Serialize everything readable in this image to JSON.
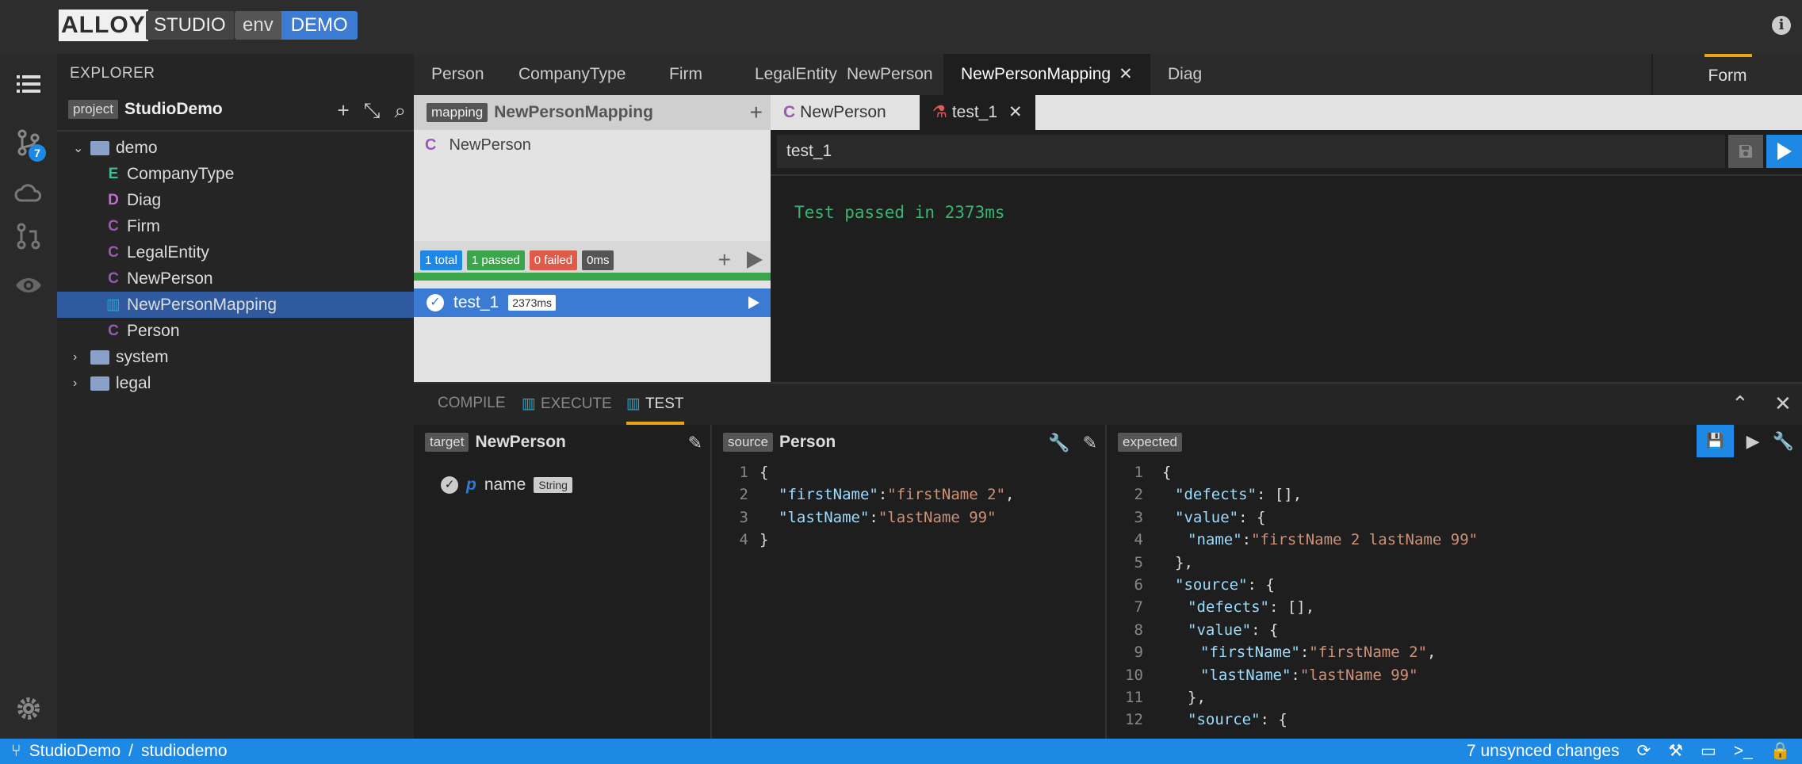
{
  "header": {
    "logo": "ALLOY",
    "studio": "STUDIO",
    "env_label": "env",
    "env_value": "DEMO"
  },
  "activity": {
    "badge_count": "7"
  },
  "explorer": {
    "title": "EXPLORER",
    "project_tag": "project",
    "project_name": "StudioDemo",
    "tree": [
      {
        "label": "demo",
        "type": "folder-open"
      },
      {
        "label": "CompanyType",
        "icon": "E",
        "color": "#3fbf8f"
      },
      {
        "label": "Diag",
        "icon": "D",
        "color": "#c26dd0"
      },
      {
        "label": "Firm",
        "icon": "C",
        "color": "#9b59b6"
      },
      {
        "label": "LegalEntity",
        "icon": "C",
        "color": "#9b59b6"
      },
      {
        "label": "NewPerson",
        "icon": "C",
        "color": "#9b59b6"
      },
      {
        "label": "NewPersonMapping",
        "icon": "map",
        "color": "#2aa3c4",
        "selected": true
      },
      {
        "label": "Person",
        "icon": "C",
        "color": "#9b59b6"
      },
      {
        "label": "system",
        "type": "folder"
      },
      {
        "label": "legal",
        "type": "folder"
      }
    ]
  },
  "tabs": [
    "Person",
    "CompanyType",
    "Firm",
    "LegalEntity",
    "NewPerson",
    "NewPersonMapping",
    "Diag"
  ],
  "form_tab": "Form",
  "mapping": {
    "tag": "mapping",
    "name": "NewPersonMapping",
    "class_icon": "C",
    "class_name": "NewPerson",
    "stats": {
      "total": "1 total",
      "passed": "1 passed",
      "failed": "0 failed",
      "time": "0ms"
    },
    "test": {
      "name": "test_1",
      "time": "2373ms"
    }
  },
  "test_tabs": {
    "class_icon": "C",
    "class_tab": "NewPerson",
    "test_tab": "test_1"
  },
  "test_name_value": "test_1",
  "test_result": "Test passed in 2373ms",
  "bottom": {
    "tabs": [
      "COMPILE",
      "EXECUTE",
      "TEST"
    ],
    "target_tag": "target",
    "target_name": "NewPerson",
    "prop_letter": "p",
    "prop_name": "name",
    "prop_type": "String",
    "source_tag": "source",
    "source_name": "Person",
    "expected_tag": "expected"
  },
  "source_code": [
    {
      "n": "1",
      "t": "{"
    },
    {
      "n": "2",
      "k": "\"firstName\"",
      "v": "\"firstName 2\"",
      "e": ","
    },
    {
      "n": "3",
      "k": "\"lastName\"",
      "v": "\"lastName 99\"",
      "e": ""
    },
    {
      "n": "4",
      "t": "}"
    }
  ],
  "expected_code": [
    {
      "n": "1",
      "i": 0,
      "t": "{"
    },
    {
      "n": "2",
      "i": 1,
      "k": "\"defects\"",
      "p": ": [],"
    },
    {
      "n": "3",
      "i": 1,
      "k": "\"value\"",
      "p": ": {"
    },
    {
      "n": "4",
      "i": 2,
      "k": "\"name\"",
      "v": "\"firstName 2 lastName 99\"",
      "e": ""
    },
    {
      "n": "5",
      "i": 1,
      "t": "},"
    },
    {
      "n": "6",
      "i": 1,
      "k": "\"source\"",
      "p": ": {"
    },
    {
      "n": "7",
      "i": 2,
      "k": "\"defects\"",
      "p": ": [],"
    },
    {
      "n": "8",
      "i": 2,
      "k": "\"value\"",
      "p": ": {"
    },
    {
      "n": "9",
      "i": 3,
      "k": "\"firstName\"",
      "v": "\"firstName 2\"",
      "e": ","
    },
    {
      "n": "10",
      "i": 3,
      "k": "\"lastName\"",
      "v": "\"lastName 99\"",
      "e": ""
    },
    {
      "n": "11",
      "i": 2,
      "t": "},"
    },
    {
      "n": "12",
      "i": 2,
      "k": "\"source\"",
      "p": ": {"
    }
  ],
  "status": {
    "project": "StudioDemo",
    "separator": "/",
    "workspace": "studiodemo",
    "unsynced": "7 unsynced changes"
  }
}
